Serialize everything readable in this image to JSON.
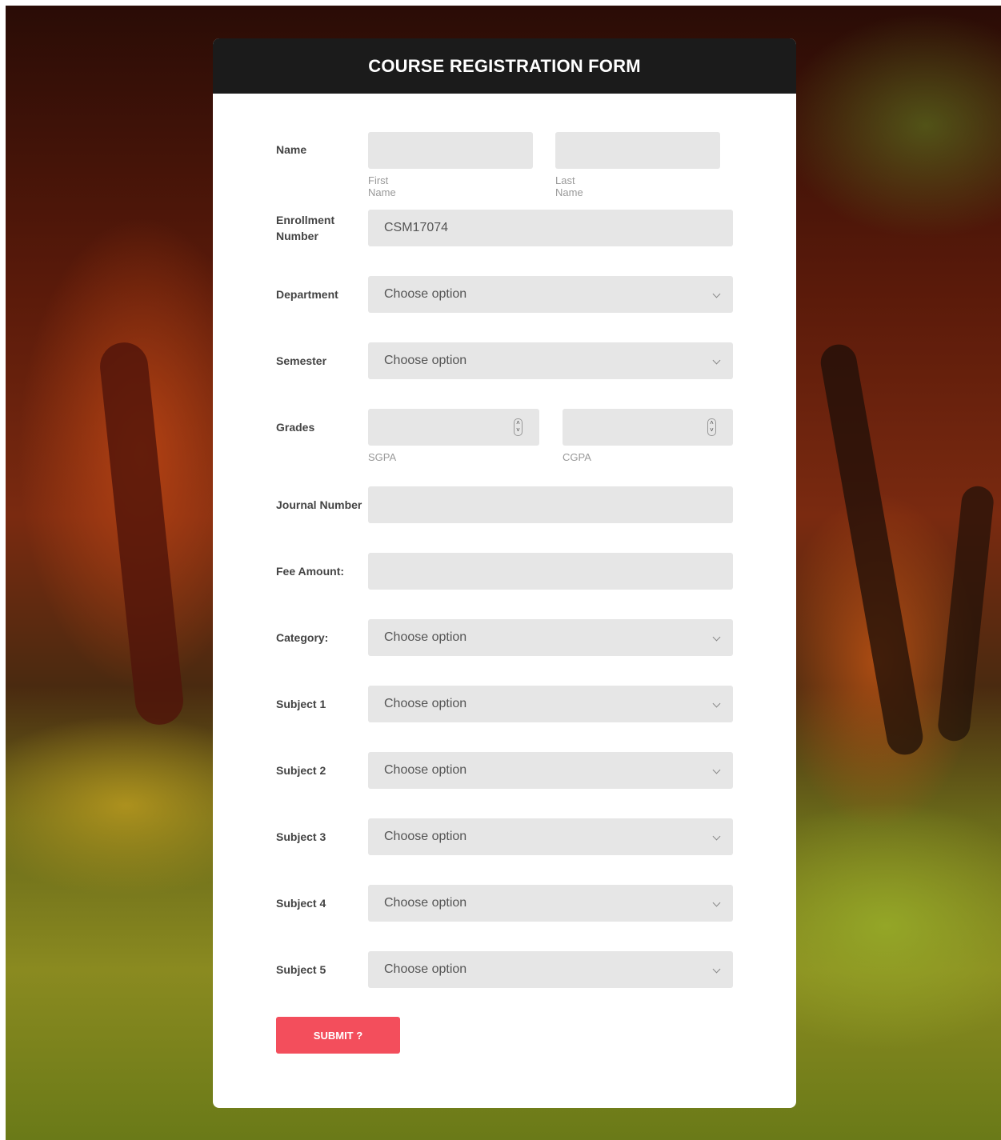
{
  "header": {
    "title": "COURSE REGISTRATION FORM"
  },
  "fields": {
    "name": {
      "label": "Name",
      "first_sub": "First Name",
      "last_sub": "Last Name",
      "first_value": "",
      "last_value": ""
    },
    "enrollment": {
      "label": "Enrollment Number",
      "value": "CSM17074"
    },
    "department": {
      "label": "Department",
      "value": "Choose option"
    },
    "semester": {
      "label": "Semester",
      "value": "Choose option"
    },
    "grades": {
      "label": "Grades",
      "sgpa_sub": "SGPA",
      "cgpa_sub": "CGPA"
    },
    "journal": {
      "label": "Journal Number",
      "value": ""
    },
    "fee": {
      "label": "Fee Amount:",
      "value": ""
    },
    "category": {
      "label": "Category:",
      "value": "Choose option"
    },
    "subject1": {
      "label": "Subject 1",
      "value": "Choose option"
    },
    "subject2": {
      "label": "Subject 2",
      "value": "Choose option"
    },
    "subject3": {
      "label": "Subject 3",
      "value": "Choose option"
    },
    "subject4": {
      "label": "Subject 4",
      "value": "Choose option"
    },
    "subject5": {
      "label": "Subject 5",
      "value": "Choose option"
    }
  },
  "submit": {
    "label": "SUBMIT ?"
  },
  "icons": {
    "select": "chevron-down-icon",
    "number": "spinner-icon"
  },
  "colors": {
    "header_bg": "#1b1b1b",
    "field_bg": "#e6e6e6",
    "submit_bg": "#f34e5c"
  }
}
